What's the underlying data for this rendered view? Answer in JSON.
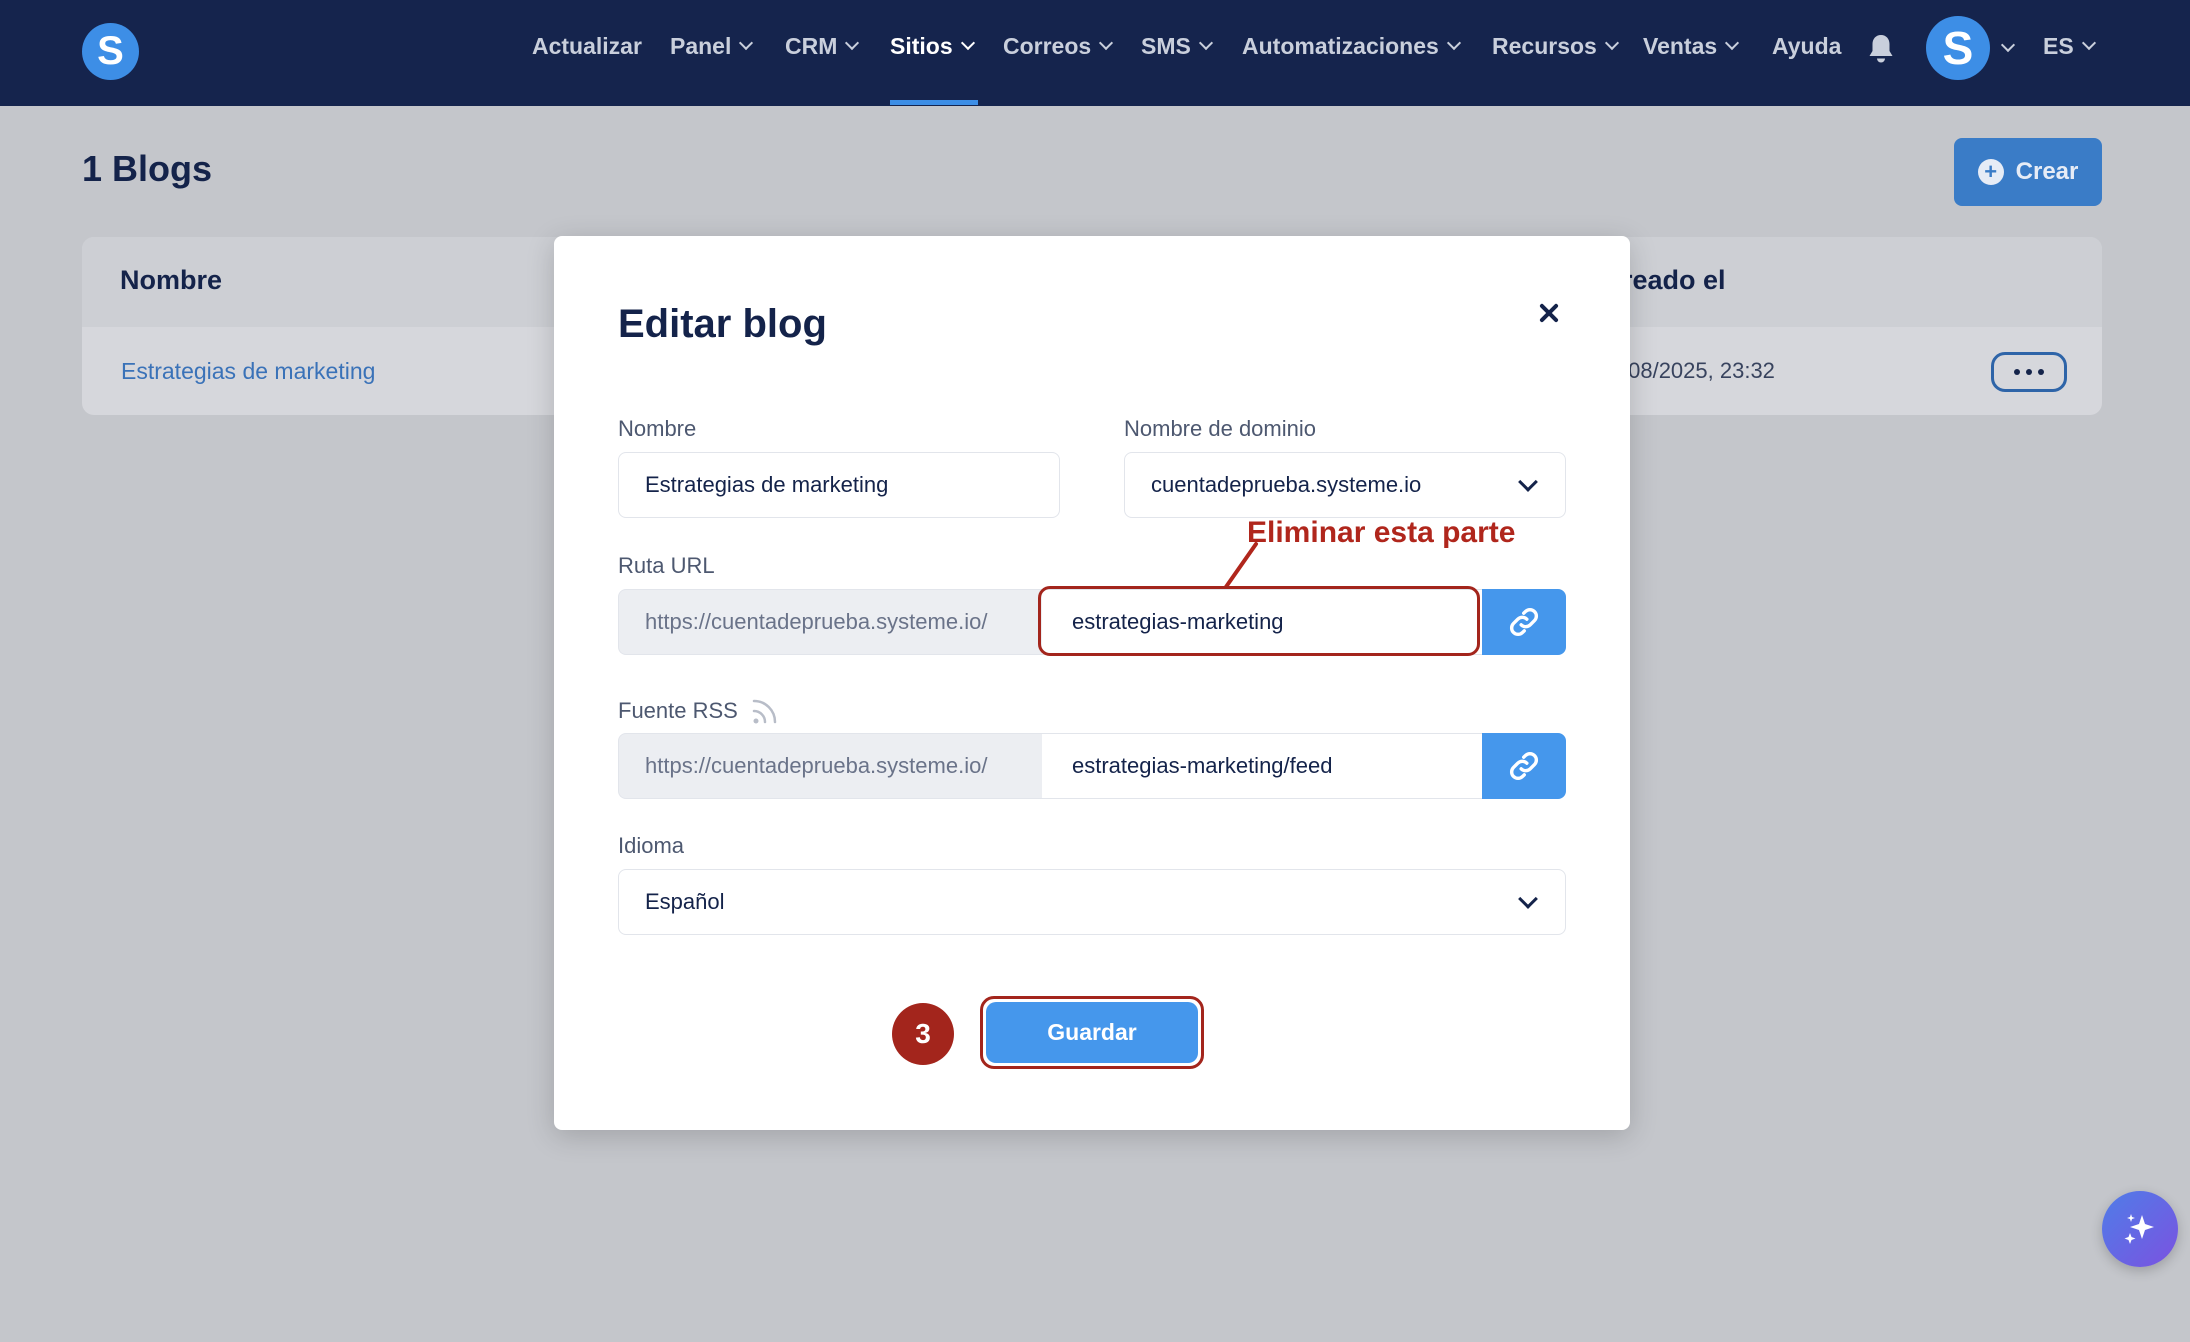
{
  "nav": {
    "logo_letter": "S",
    "items": [
      {
        "label": "Actualizar",
        "dropdown": false
      },
      {
        "label": "Panel",
        "dropdown": true
      },
      {
        "label": "CRM",
        "dropdown": true
      },
      {
        "label": "Sitios",
        "dropdown": true,
        "active": true
      },
      {
        "label": "Correos",
        "dropdown": true
      },
      {
        "label": "SMS",
        "dropdown": true
      },
      {
        "label": "Automatizaciones",
        "dropdown": true
      },
      {
        "label": "Recursos",
        "dropdown": true
      },
      {
        "label": "Ventas",
        "dropdown": true
      },
      {
        "label": "Ayuda",
        "dropdown": false
      }
    ],
    "avatar_letter": "S",
    "language": "ES"
  },
  "page": {
    "title": "1 Blogs",
    "create_label": "Crear",
    "table": {
      "col_name": "Nombre",
      "col_created": "reado el",
      "row": {
        "name": "Estrategias de marketing",
        "created": "/08/2025, 23:32"
      }
    }
  },
  "modal": {
    "title": "Editar blog",
    "name_label": "Nombre",
    "name_value": "Estrategias de marketing",
    "domain_label": "Nombre de dominio",
    "domain_value": "cuentadeprueba.systeme.io",
    "url_label": "Ruta URL",
    "url_prefix": "https://cuentadeprueba.systeme.io/",
    "url_path": "estrategias-marketing",
    "rss_label": "Fuente RSS",
    "rss_prefix": "https://cuentadeprueba.systeme.io/",
    "rss_path": "estrategias-marketing/feed",
    "language_label": "Idioma",
    "language_value": "Español",
    "save_label": "Guardar"
  },
  "annotations": {
    "hint_text": "Eliminar esta parte",
    "step_number": "3",
    "color": "#a3251c"
  },
  "colors": {
    "nav_bg": "#15244d",
    "accent": "#4597ec",
    "page_bg": "#c4c6cb"
  }
}
